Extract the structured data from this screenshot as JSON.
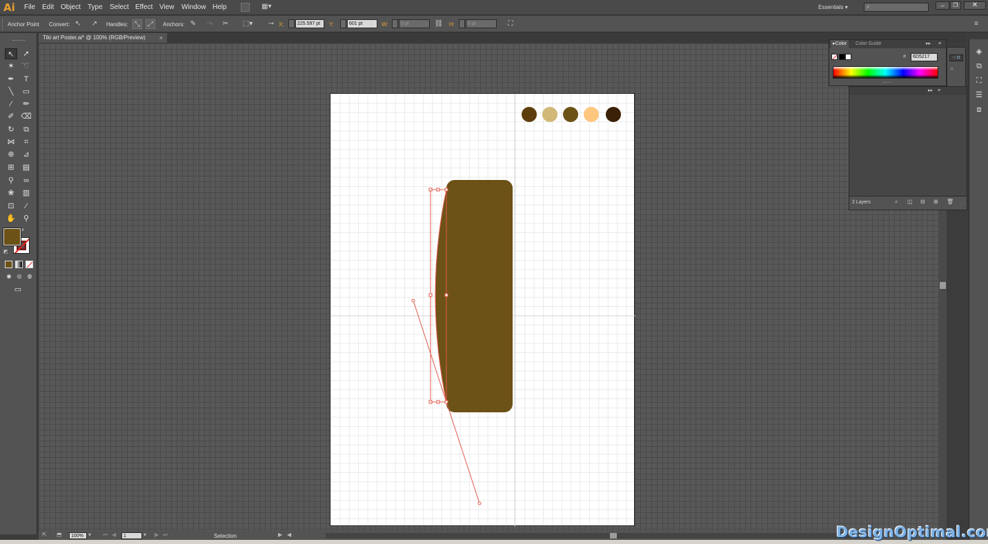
{
  "app": {
    "logo": "Ai",
    "menu": [
      "File",
      "Edit",
      "Object",
      "Type",
      "Select",
      "Effect",
      "View",
      "Window",
      "Help"
    ],
    "workspace": "Essentials",
    "search_placeholder": ""
  },
  "control_bar": {
    "anchor_point_label": "Anchor Point",
    "convert_label": "Convert:",
    "handles_label": "Handles:",
    "anchors_label": "Anchors:",
    "x_label": "X:",
    "x_value": "225.597 pt",
    "y_label": "Y:",
    "y_value": "601 pt",
    "w_label": "W:",
    "w_value": "0 pt",
    "h_label": "H:",
    "h_value": "0 pt"
  },
  "document": {
    "tab_title": "Tiki art Poster.ai* @ 100% (RGB/Preview)",
    "close": "×"
  },
  "swatches": {
    "colors": [
      "#5e3d0c",
      "#d1b877",
      "#6d5217",
      "#ffc67e",
      "#3a2107"
    ]
  },
  "shape": {
    "fill": "#6d5217",
    "path_color": "#e0584a"
  },
  "color_panel": {
    "tab_color": "Color",
    "tab_guide": "Color Guide",
    "hex_prefix": "#",
    "hex_value": "6D5217"
  },
  "layers_panel": {
    "count_label": "2 Layers"
  },
  "status_bar": {
    "zoom": "100%",
    "artboard_number": "1",
    "tool_status": "Selection"
  },
  "toolbox": {
    "fill_color": "#6d5217",
    "stroke_color": "#7a1c1c"
  },
  "watermark": "DesignOptimal.com"
}
